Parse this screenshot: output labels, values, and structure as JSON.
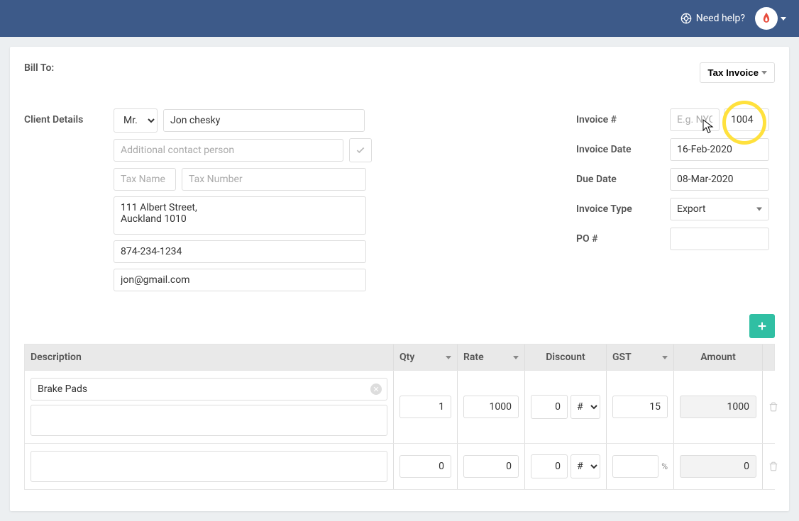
{
  "header": {
    "need_help": "Need help?"
  },
  "labels": {
    "bill_to": "Bill To:",
    "client_details": "Client Details",
    "invoice_num": "Invoice #",
    "invoice_date": "Invoice Date",
    "due_date": "Due Date",
    "invoice_type": "Invoice Type",
    "po_num": "PO #",
    "tax_invoice": "Tax Invoice"
  },
  "client": {
    "title": "Mr.",
    "name": "Jon chesky",
    "contact_placeholder": "Additional contact person",
    "tax_name_placeholder": "Tax Name",
    "tax_number_placeholder": "Tax Number",
    "address": "111 Albert Street,\nAuckland 1010",
    "phone": "874-234-1234",
    "email": "jon@gmail.com"
  },
  "invoice": {
    "prefix_placeholder": "E.g. NYC",
    "number": "1004",
    "date": "16-Feb-2020",
    "due": "08-Mar-2020",
    "type": "Export",
    "po": ""
  },
  "table": {
    "headers": {
      "description": "Description",
      "qty": "Qty",
      "rate": "Rate",
      "discount": "Discount",
      "gst": "GST",
      "amount": "Amount"
    },
    "rows": [
      {
        "desc": "Brake Pads",
        "qty": "1",
        "rate": "1000",
        "discount": "0",
        "disc_type": "#",
        "gst": "15",
        "gst_suffix": "",
        "amount": "1000"
      },
      {
        "desc": "",
        "qty": "0",
        "rate": "0",
        "discount": "0",
        "disc_type": "#",
        "gst": "",
        "gst_suffix": "%",
        "amount": "0"
      }
    ]
  }
}
